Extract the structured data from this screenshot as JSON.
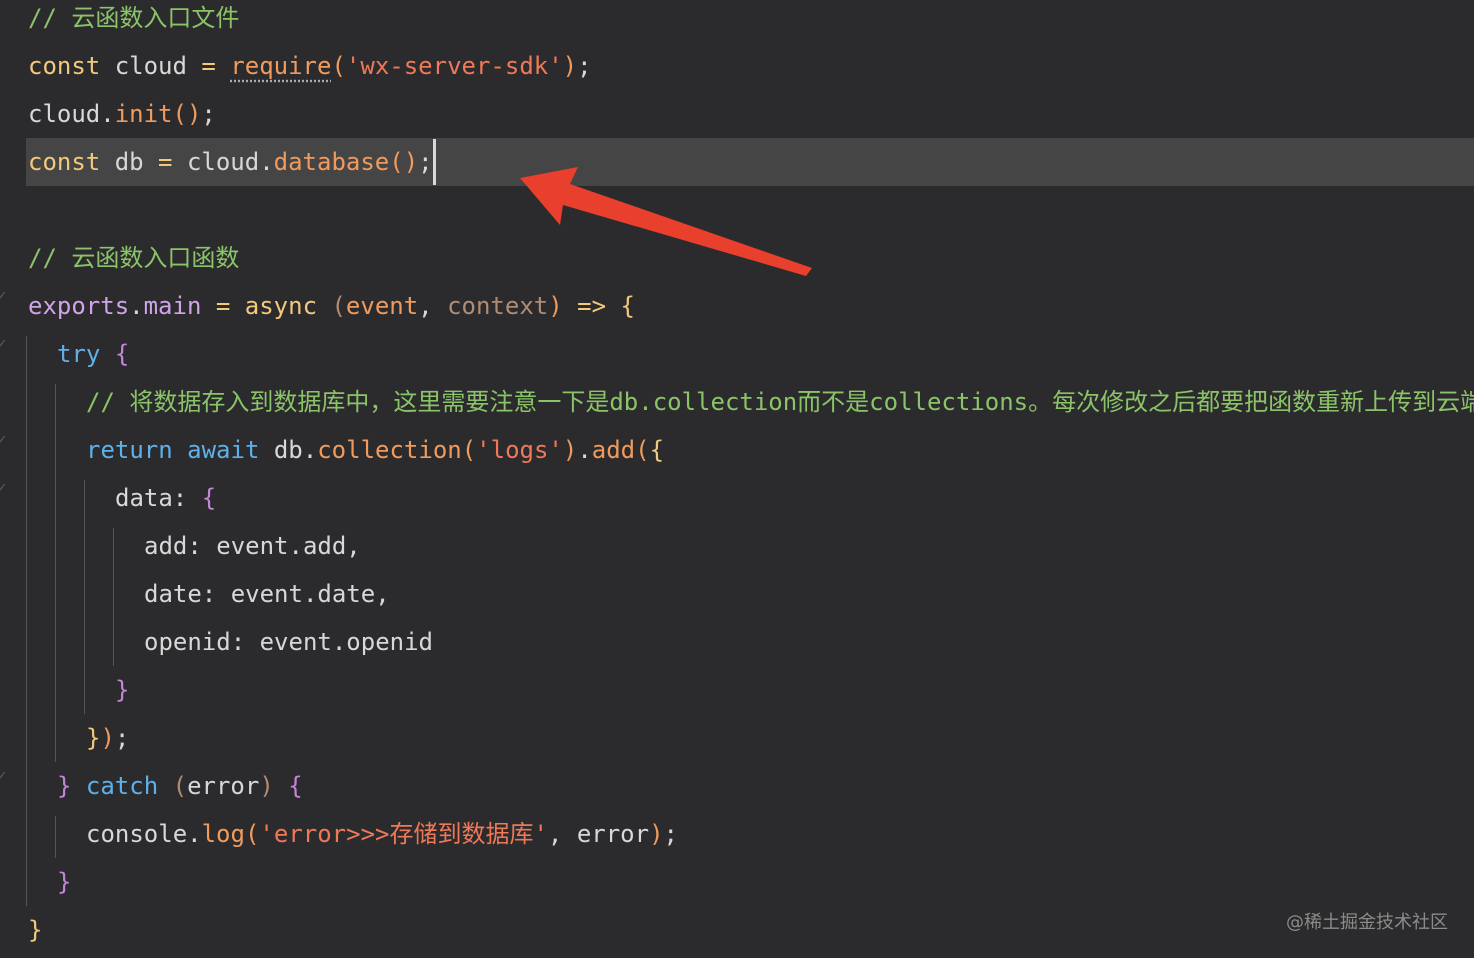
{
  "editor": {
    "lines": [
      {
        "indent": 0,
        "tokens": [
          {
            "t": "// 云函数入口文件",
            "c": "com"
          }
        ]
      },
      {
        "indent": 0,
        "tokens": [
          {
            "t": "const",
            "c": "kw"
          },
          {
            "t": " cloud ",
            "c": "id"
          },
          {
            "t": "=",
            "c": "op"
          },
          {
            "t": " ",
            "c": "id"
          },
          {
            "t": "require",
            "c": "fn squig"
          },
          {
            "t": "(",
            "c": "par"
          },
          {
            "t": "'wx-server-sdk'",
            "c": "str"
          },
          {
            "t": ")",
            "c": "par"
          },
          {
            "t": ";",
            "c": "pn"
          }
        ]
      },
      {
        "indent": 0,
        "tokens": [
          {
            "t": "cloud",
            "c": "id"
          },
          {
            "t": ".",
            "c": "pn"
          },
          {
            "t": "init",
            "c": "fn"
          },
          {
            "t": "()",
            "c": "par"
          },
          {
            "t": ";",
            "c": "pn"
          }
        ]
      },
      {
        "indent": 0,
        "current": true,
        "tokens": [
          {
            "t": "const",
            "c": "kw"
          },
          {
            "t": " db ",
            "c": "id"
          },
          {
            "t": "=",
            "c": "op"
          },
          {
            "t": " cloud",
            "c": "id"
          },
          {
            "t": ".",
            "c": "pn"
          },
          {
            "t": "database",
            "c": "fn"
          },
          {
            "t": "()",
            "c": "par"
          },
          {
            "t": ";",
            "c": "pn"
          }
        ]
      },
      {
        "indent": 0,
        "tokens": []
      },
      {
        "indent": 0,
        "tokens": [
          {
            "t": "// 云函数入口函数",
            "c": "com"
          }
        ]
      },
      {
        "indent": 0,
        "tokens": [
          {
            "t": "exports",
            "c": "prop"
          },
          {
            "t": ".",
            "c": "pn"
          },
          {
            "t": "main",
            "c": "prop"
          },
          {
            "t": " = ",
            "c": "op"
          },
          {
            "t": "async",
            "c": "kw"
          },
          {
            "t": " ",
            "c": "id"
          },
          {
            "t": "(",
            "c": "par-dim"
          },
          {
            "t": "event",
            "c": "fn"
          },
          {
            "t": ", ",
            "c": "pn"
          },
          {
            "t": "context",
            "c": "par-dim"
          },
          {
            "t": ")",
            "c": "par"
          },
          {
            "t": " => ",
            "c": "op"
          },
          {
            "t": "{",
            "c": "br1"
          }
        ]
      },
      {
        "indent": 1,
        "tokens": [
          {
            "t": "try",
            "c": "kw2"
          },
          {
            "t": " ",
            "c": "id"
          },
          {
            "t": "{",
            "c": "br2"
          }
        ]
      },
      {
        "indent": 2,
        "tokens": [
          {
            "t": "// 将数据存入到数据库中，这里需要注意一下是db.collection而不是collections。每次修改之后都要把函数重新上传到云端",
            "c": "com"
          }
        ]
      },
      {
        "indent": 2,
        "tokens": [
          {
            "t": "return",
            "c": "kw2"
          },
          {
            "t": " ",
            "c": "id"
          },
          {
            "t": "await",
            "c": "kw2"
          },
          {
            "t": " db",
            "c": "id"
          },
          {
            "t": ".",
            "c": "pn"
          },
          {
            "t": "collection",
            "c": "fn"
          },
          {
            "t": "(",
            "c": "par"
          },
          {
            "t": "'logs'",
            "c": "str"
          },
          {
            "t": ")",
            "c": "par"
          },
          {
            "t": ".",
            "c": "pn"
          },
          {
            "t": "add",
            "c": "fn"
          },
          {
            "t": "(",
            "c": "par"
          },
          {
            "t": "{",
            "c": "br1"
          }
        ]
      },
      {
        "indent": 3,
        "tokens": [
          {
            "t": "data: ",
            "c": "id"
          },
          {
            "t": "{",
            "c": "br2"
          }
        ]
      },
      {
        "indent": 4,
        "tokens": [
          {
            "t": "add: event",
            "c": "id"
          },
          {
            "t": ".",
            "c": "pn"
          },
          {
            "t": "add,",
            "c": "id"
          }
        ]
      },
      {
        "indent": 4,
        "tokens": [
          {
            "t": "date: event",
            "c": "id"
          },
          {
            "t": ".",
            "c": "pn"
          },
          {
            "t": "date,",
            "c": "id"
          }
        ]
      },
      {
        "indent": 4,
        "tokens": [
          {
            "t": "openid: event",
            "c": "id"
          },
          {
            "t": ".",
            "c": "pn"
          },
          {
            "t": "openid",
            "c": "id"
          }
        ]
      },
      {
        "indent": 3,
        "tokens": [
          {
            "t": "}",
            "c": "br2"
          }
        ]
      },
      {
        "indent": 2,
        "tokens": [
          {
            "t": "}",
            "c": "br1"
          },
          {
            "t": ")",
            "c": "par"
          },
          {
            "t": ";",
            "c": "pn"
          }
        ]
      },
      {
        "indent": 1,
        "tokens": [
          {
            "t": "}",
            "c": "br2"
          },
          {
            "t": " ",
            "c": "id"
          },
          {
            "t": "catch",
            "c": "kw2"
          },
          {
            "t": " ",
            "c": "id"
          },
          {
            "t": "(",
            "c": "par-dim"
          },
          {
            "t": "error",
            "c": "id"
          },
          {
            "t": ")",
            "c": "par-dim"
          },
          {
            "t": " ",
            "c": "id"
          },
          {
            "t": "{",
            "c": "br2"
          }
        ]
      },
      {
        "indent": 2,
        "tokens": [
          {
            "t": "console",
            "c": "id"
          },
          {
            "t": ".",
            "c": "pn"
          },
          {
            "t": "log",
            "c": "fn"
          },
          {
            "t": "(",
            "c": "par"
          },
          {
            "t": "'error>>>存储到数据库'",
            "c": "str"
          },
          {
            "t": ", error",
            "c": "id"
          },
          {
            "t": ")",
            "c": "par"
          },
          {
            "t": ";",
            "c": "pn"
          }
        ]
      },
      {
        "indent": 1,
        "tokens": [
          {
            "t": "}",
            "c": "br2"
          }
        ]
      },
      {
        "indent": 0,
        "tokens": [
          {
            "t": "}",
            "c": "br1"
          }
        ]
      }
    ]
  },
  "annotation": {
    "arrow_color": "#e8402d",
    "label": "red-arrow"
  },
  "watermark": "@稀土掘金技术社区",
  "colors": {
    "background": "#2b2b2d",
    "current_line": "#454545",
    "comment": "#8bc468",
    "keyword": "#f2c97d",
    "string": "#f07858",
    "function": "#f09b5d"
  }
}
